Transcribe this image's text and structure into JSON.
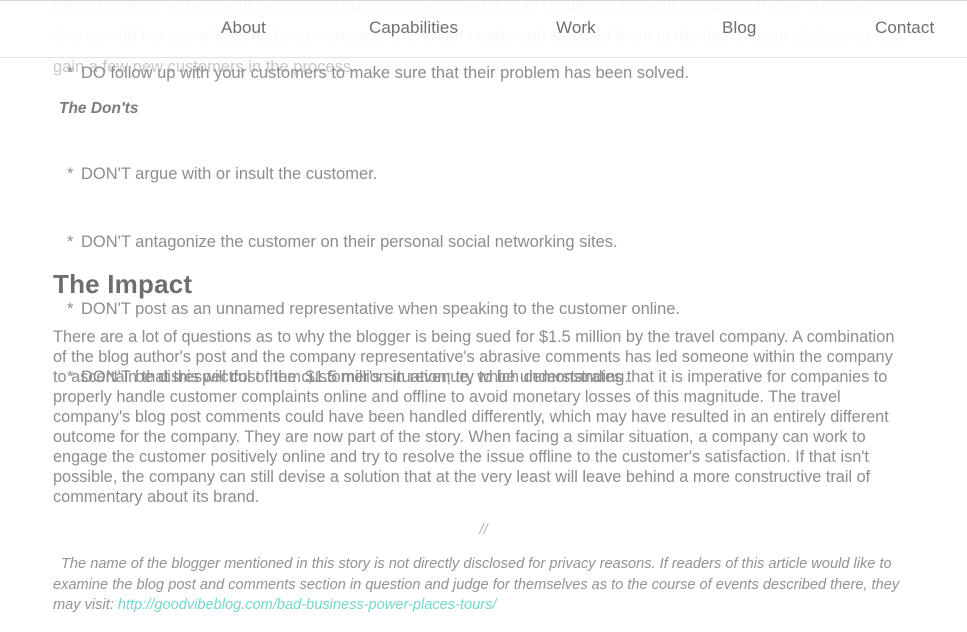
{
  "nav": {
    "items": [
      {
        "key": "about",
        "label": "About"
      },
      {
        "key": "capabilities",
        "label": "Capabilities"
      },
      {
        "key": "work",
        "label": "Work"
      },
      {
        "key": "blog",
        "label": "Blog"
      },
      {
        "key": "contact",
        "label": "Contact"
      }
    ]
  },
  "article": {
    "faded_paragraph": "posted online. Helping your disgruntled customers will build a solid reputation for your company. If your customer shares with her social pals that you were attentive to her needs and satisfied them to the best of your ability, you may gain a few new customers in the process.",
    "bullet_marker": "*",
    "do_item": "DO follow up with your customers to make sure that their problem has been solved.",
    "donts_subhead": "The Don'ts",
    "dont_items": [
      "DON'T argue with or insult the customer.",
      "DON'T antagonize the customer on their personal social networking sites.",
      "DON'T post as an unnamed representative when speaking to the customer online.",
      "DON'T be disrespectful of the customer's situation; try to be understanding."
    ],
    "impact_heading": "The Impact",
    "impact_paragraph": "There are a lot of questions as to why the blogger is being sued for $1.5 million by the travel company. A combination of the blog author's post and the company representative's abrasive comments has led someone within the company to ascertain that this will cost them $1.5 million in revenue, which demonstrates that it is imperative for companies to properly handle customer complaints online and offline to avoid monetary losses of this magnitude.   The travel company's blog post comments could have been handled differently, which may have resulted in an entirely different outcome for the company. They are now part of the story. When facing a similar situation, a company can work to engage the customer positively online and try to resolve the issue offline to the customer's satisfaction. If that isn't possible, the company can still devise a solution that at the very least will leave behind a more constructive trail of commentary about its brand.",
    "divider": "//",
    "footnote_text": "The name of the blogger mentioned in this story is not directly disclosed for privacy reasons. If readers of this article would like to examine the blog post and comments section in question and judge for themselves as to the course of events described there, they may visit: ",
    "footnote_link": "http://goodvibeblog.com/bad-business-power-places-tours/"
  },
  "colors": {
    "link": "#74d7cc",
    "body_text": "#8d8d8d",
    "heading": "#6e6e6e",
    "nav_text": "#6f6f6f",
    "faded_text": "#c9c9c9",
    "background": "#ffffff"
  }
}
